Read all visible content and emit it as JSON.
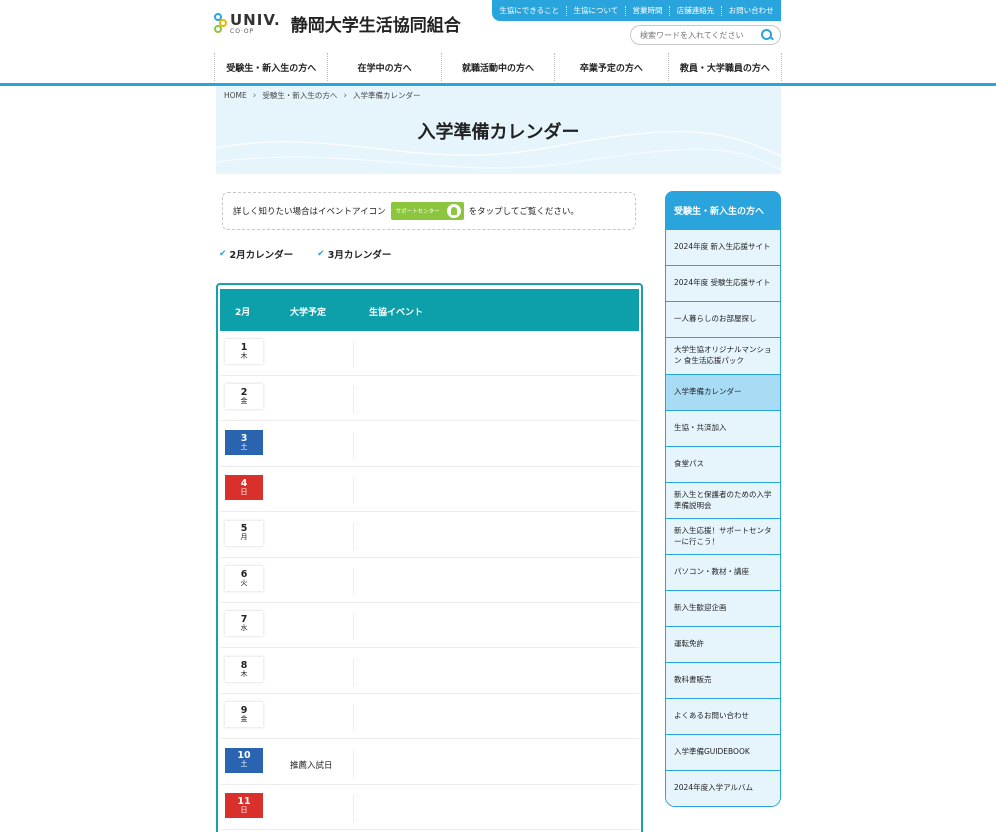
{
  "header": {
    "logo_univ": "UNIV.",
    "logo_coop": "CO·OP",
    "logo_title": "静岡大学生活協同組合",
    "top_links": [
      "生協にできること",
      "生協について",
      "営業時間",
      "店舗連絡先",
      "お問い合わせ"
    ],
    "search_placeholder": "検索ワードを入れてください",
    "nav": [
      "受験生・新入生の方へ",
      "在学中の方へ",
      "就職活動中の方へ",
      "卒業予定の方へ",
      "教員・大学職員の方へ"
    ]
  },
  "breadcrumb": [
    "HOME",
    "受験生・新入生の方へ",
    "入学準備カレンダー"
  ],
  "page_title": "入学準備カレンダー",
  "info": {
    "before": "詳しく知りたい場合はイベントアイコン",
    "badge_label": "サポートセンター",
    "after": "をタップしてご覧ください。"
  },
  "month_links": [
    "2月カレンダー",
    "3月カレンダー"
  ],
  "calendar": {
    "headers": [
      "2月",
      "大学予定",
      "生協イベント"
    ],
    "days": [
      {
        "date": "1",
        "weekday": "木",
        "type": "weekday",
        "event": ""
      },
      {
        "date": "2",
        "weekday": "金",
        "type": "weekday",
        "event": ""
      },
      {
        "date": "3",
        "weekday": "土",
        "type": "sat",
        "event": ""
      },
      {
        "date": "4",
        "weekday": "日",
        "type": "sun",
        "event": ""
      },
      {
        "date": "5",
        "weekday": "月",
        "type": "weekday",
        "event": ""
      },
      {
        "date": "6",
        "weekday": "火",
        "type": "weekday",
        "event": ""
      },
      {
        "date": "7",
        "weekday": "水",
        "type": "weekday",
        "event": ""
      },
      {
        "date": "8",
        "weekday": "木",
        "type": "weekday",
        "event": ""
      },
      {
        "date": "9",
        "weekday": "金",
        "type": "weekday",
        "event": ""
      },
      {
        "date": "10",
        "weekday": "土",
        "type": "sat",
        "event": "推薦入試日"
      },
      {
        "date": "11",
        "weekday": "日",
        "type": "sun",
        "event": ""
      }
    ]
  },
  "side_nav": {
    "title": "受験生・新入生の方へ",
    "items": [
      "2024年度 新入生応援サイト",
      "2024年度 受験生応援サイト",
      "一人暮らしのお部屋探し",
      "大学生協オリジナルマンション 食生活応援パック",
      "入学準備カレンダー",
      "生協・共済加入",
      "食堂パス",
      "新入生と保護者のための入学準備説明会",
      "新入生応援！サポートセンターに行こう！",
      "パソコン・教材・講座",
      "新入生歓迎企画",
      "運転免許",
      "教科書販売",
      "よくあるお問い合わせ",
      "入学準備GUIDEBOOK",
      "2024年度入学アルバム"
    ],
    "active_index": 4
  },
  "colors": {
    "brand_blue": "#2aa4dc",
    "table_teal": "#0da0aa",
    "saturday": "#2a64b1",
    "sunday": "#d9302c",
    "support_green": "#8cc63f"
  }
}
